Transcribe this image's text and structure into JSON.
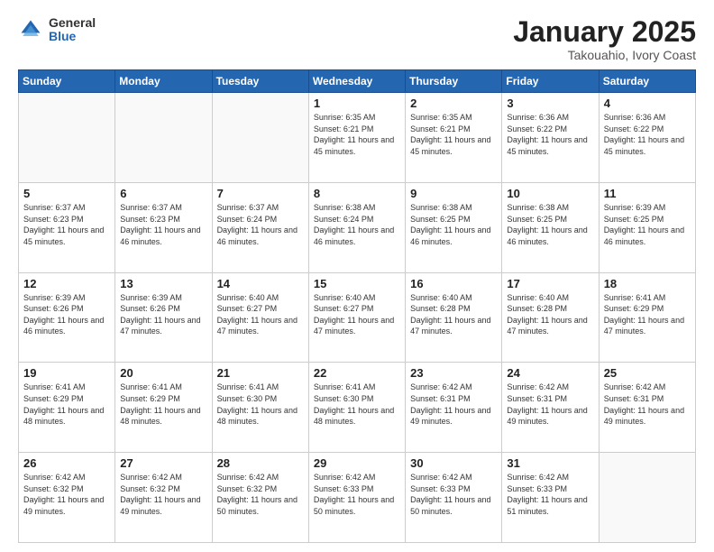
{
  "logo": {
    "general": "General",
    "blue": "Blue"
  },
  "header": {
    "month": "January 2025",
    "location": "Takouahio, Ivory Coast"
  },
  "weekdays": [
    "Sunday",
    "Monday",
    "Tuesday",
    "Wednesday",
    "Thursday",
    "Friday",
    "Saturday"
  ],
  "weeks": [
    [
      {
        "day": "",
        "info": ""
      },
      {
        "day": "",
        "info": ""
      },
      {
        "day": "",
        "info": ""
      },
      {
        "day": "1",
        "info": "Sunrise: 6:35 AM\nSunset: 6:21 PM\nDaylight: 11 hours\nand 45 minutes."
      },
      {
        "day": "2",
        "info": "Sunrise: 6:35 AM\nSunset: 6:21 PM\nDaylight: 11 hours\nand 45 minutes."
      },
      {
        "day": "3",
        "info": "Sunrise: 6:36 AM\nSunset: 6:22 PM\nDaylight: 11 hours\nand 45 minutes."
      },
      {
        "day": "4",
        "info": "Sunrise: 6:36 AM\nSunset: 6:22 PM\nDaylight: 11 hours\nand 45 minutes."
      }
    ],
    [
      {
        "day": "5",
        "info": "Sunrise: 6:37 AM\nSunset: 6:23 PM\nDaylight: 11 hours\nand 45 minutes."
      },
      {
        "day": "6",
        "info": "Sunrise: 6:37 AM\nSunset: 6:23 PM\nDaylight: 11 hours\nand 46 minutes."
      },
      {
        "day": "7",
        "info": "Sunrise: 6:37 AM\nSunset: 6:24 PM\nDaylight: 11 hours\nand 46 minutes."
      },
      {
        "day": "8",
        "info": "Sunrise: 6:38 AM\nSunset: 6:24 PM\nDaylight: 11 hours\nand 46 minutes."
      },
      {
        "day": "9",
        "info": "Sunrise: 6:38 AM\nSunset: 6:25 PM\nDaylight: 11 hours\nand 46 minutes."
      },
      {
        "day": "10",
        "info": "Sunrise: 6:38 AM\nSunset: 6:25 PM\nDaylight: 11 hours\nand 46 minutes."
      },
      {
        "day": "11",
        "info": "Sunrise: 6:39 AM\nSunset: 6:25 PM\nDaylight: 11 hours\nand 46 minutes."
      }
    ],
    [
      {
        "day": "12",
        "info": "Sunrise: 6:39 AM\nSunset: 6:26 PM\nDaylight: 11 hours\nand 46 minutes."
      },
      {
        "day": "13",
        "info": "Sunrise: 6:39 AM\nSunset: 6:26 PM\nDaylight: 11 hours\nand 47 minutes."
      },
      {
        "day": "14",
        "info": "Sunrise: 6:40 AM\nSunset: 6:27 PM\nDaylight: 11 hours\nand 47 minutes."
      },
      {
        "day": "15",
        "info": "Sunrise: 6:40 AM\nSunset: 6:27 PM\nDaylight: 11 hours\nand 47 minutes."
      },
      {
        "day": "16",
        "info": "Sunrise: 6:40 AM\nSunset: 6:28 PM\nDaylight: 11 hours\nand 47 minutes."
      },
      {
        "day": "17",
        "info": "Sunrise: 6:40 AM\nSunset: 6:28 PM\nDaylight: 11 hours\nand 47 minutes."
      },
      {
        "day": "18",
        "info": "Sunrise: 6:41 AM\nSunset: 6:29 PM\nDaylight: 11 hours\nand 47 minutes."
      }
    ],
    [
      {
        "day": "19",
        "info": "Sunrise: 6:41 AM\nSunset: 6:29 PM\nDaylight: 11 hours\nand 48 minutes."
      },
      {
        "day": "20",
        "info": "Sunrise: 6:41 AM\nSunset: 6:29 PM\nDaylight: 11 hours\nand 48 minutes."
      },
      {
        "day": "21",
        "info": "Sunrise: 6:41 AM\nSunset: 6:30 PM\nDaylight: 11 hours\nand 48 minutes."
      },
      {
        "day": "22",
        "info": "Sunrise: 6:41 AM\nSunset: 6:30 PM\nDaylight: 11 hours\nand 48 minutes."
      },
      {
        "day": "23",
        "info": "Sunrise: 6:42 AM\nSunset: 6:31 PM\nDaylight: 11 hours\nand 49 minutes."
      },
      {
        "day": "24",
        "info": "Sunrise: 6:42 AM\nSunset: 6:31 PM\nDaylight: 11 hours\nand 49 minutes."
      },
      {
        "day": "25",
        "info": "Sunrise: 6:42 AM\nSunset: 6:31 PM\nDaylight: 11 hours\nand 49 minutes."
      }
    ],
    [
      {
        "day": "26",
        "info": "Sunrise: 6:42 AM\nSunset: 6:32 PM\nDaylight: 11 hours\nand 49 minutes."
      },
      {
        "day": "27",
        "info": "Sunrise: 6:42 AM\nSunset: 6:32 PM\nDaylight: 11 hours\nand 49 minutes."
      },
      {
        "day": "28",
        "info": "Sunrise: 6:42 AM\nSunset: 6:32 PM\nDaylight: 11 hours\nand 50 minutes."
      },
      {
        "day": "29",
        "info": "Sunrise: 6:42 AM\nSunset: 6:33 PM\nDaylight: 11 hours\nand 50 minutes."
      },
      {
        "day": "30",
        "info": "Sunrise: 6:42 AM\nSunset: 6:33 PM\nDaylight: 11 hours\nand 50 minutes."
      },
      {
        "day": "31",
        "info": "Sunrise: 6:42 AM\nSunset: 6:33 PM\nDaylight: 11 hours\nand 51 minutes."
      },
      {
        "day": "",
        "info": ""
      }
    ]
  ]
}
